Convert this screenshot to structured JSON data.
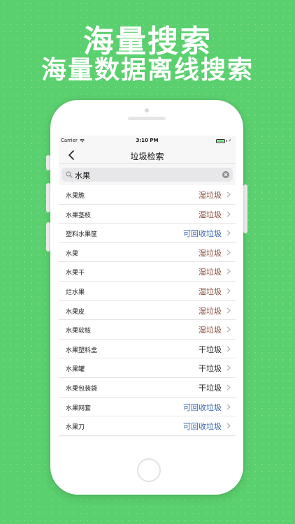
{
  "promo": {
    "title": "海量搜索",
    "subtitle": "海量数据离线搜索"
  },
  "status_bar": {
    "carrier": "Carrier",
    "time": "3:10 PM"
  },
  "nav": {
    "title": "垃圾检索"
  },
  "search": {
    "query": "水果"
  },
  "colors": {
    "background": "#5ad06e",
    "wet": "#8a4a3a",
    "dry": "#222222",
    "recyclable": "#2f5fa8"
  },
  "results": [
    {
      "name": "水果脆",
      "category": "湿垃圾",
      "type": "wet"
    },
    {
      "name": "水果茎枝",
      "category": "湿垃圾",
      "type": "wet"
    },
    {
      "name": "塑料水果筐",
      "category": "可回收垃圾",
      "type": "rec"
    },
    {
      "name": "水果",
      "category": "湿垃圾",
      "type": "wet"
    },
    {
      "name": "水果干",
      "category": "湿垃圾",
      "type": "wet"
    },
    {
      "name": "烂水果",
      "category": "湿垃圾",
      "type": "wet"
    },
    {
      "name": "水果皮",
      "category": "湿垃圾",
      "type": "wet"
    },
    {
      "name": "水果软核",
      "category": "湿垃圾",
      "type": "wet"
    },
    {
      "name": "水果塑料盒",
      "category": "干垃圾",
      "type": "dry"
    },
    {
      "name": "水果罐",
      "category": "干垃圾",
      "type": "dry"
    },
    {
      "name": "水果包装袋",
      "category": "干垃圾",
      "type": "dry"
    },
    {
      "name": "水果网套",
      "category": "可回收垃圾",
      "type": "rec"
    },
    {
      "name": "水果刀",
      "category": "可回收垃圾",
      "type": "rec"
    }
  ]
}
